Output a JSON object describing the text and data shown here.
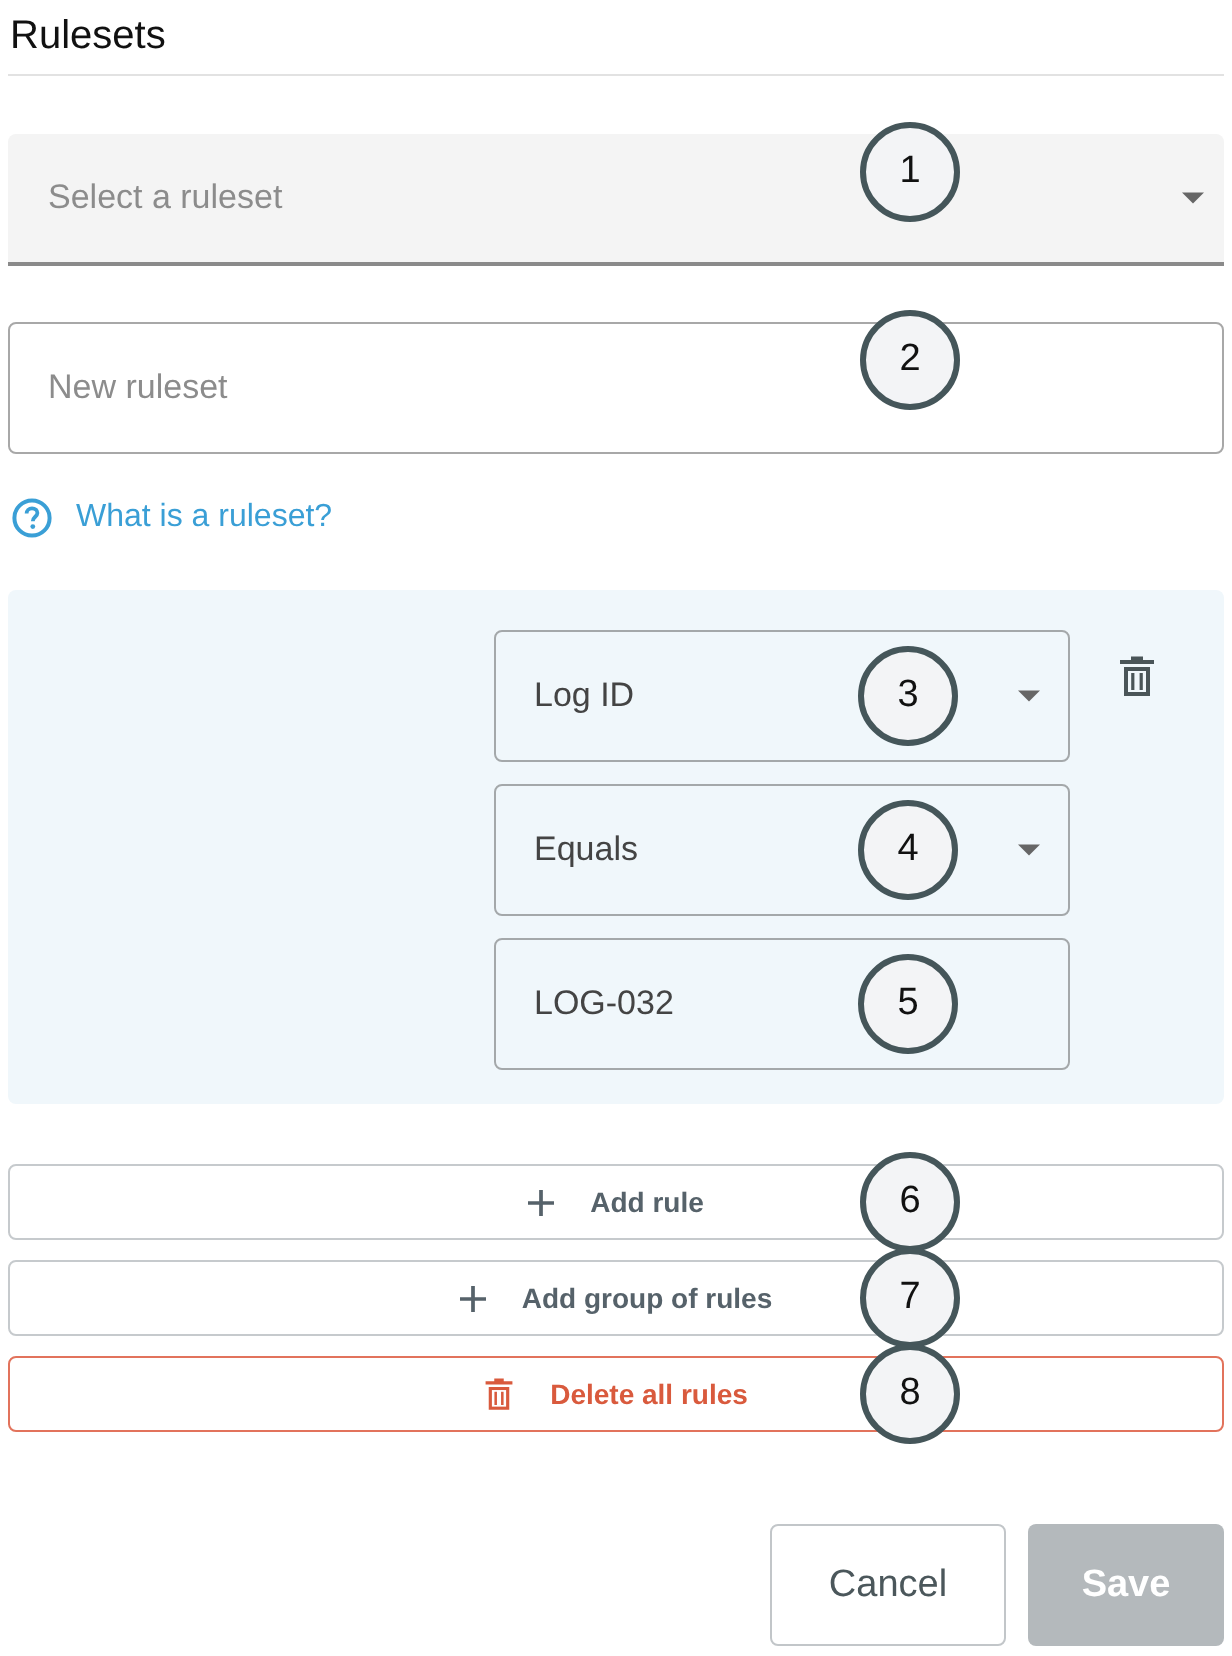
{
  "title": "Rulesets",
  "ruleset_select": {
    "placeholder": "Select a ruleset",
    "callout": "1"
  },
  "ruleset_name": {
    "placeholder": "New ruleset",
    "callout": "2"
  },
  "help_link": {
    "label": "What is a ruleset?"
  },
  "rule_group": {
    "rules": [
      {
        "fields": [
          {
            "kind": "dropdown",
            "value": "Log ID",
            "callout": "3"
          },
          {
            "kind": "dropdown",
            "value": "Equals",
            "callout": "4"
          },
          {
            "kind": "text",
            "value": "LOG-032",
            "callout": "5"
          }
        ]
      }
    ]
  },
  "actions": [
    {
      "kind": "add",
      "label": "Add rule",
      "callout": "6"
    },
    {
      "kind": "add",
      "label": "Add group of rules",
      "callout": "7"
    },
    {
      "kind": "danger",
      "label": "Delete all rules",
      "callout": "8"
    }
  ],
  "footer_buttons": [
    {
      "kind": "secondary",
      "label": "Cancel",
      "disabled": false
    },
    {
      "kind": "primary",
      "label": "Save",
      "disabled": true
    }
  ]
}
